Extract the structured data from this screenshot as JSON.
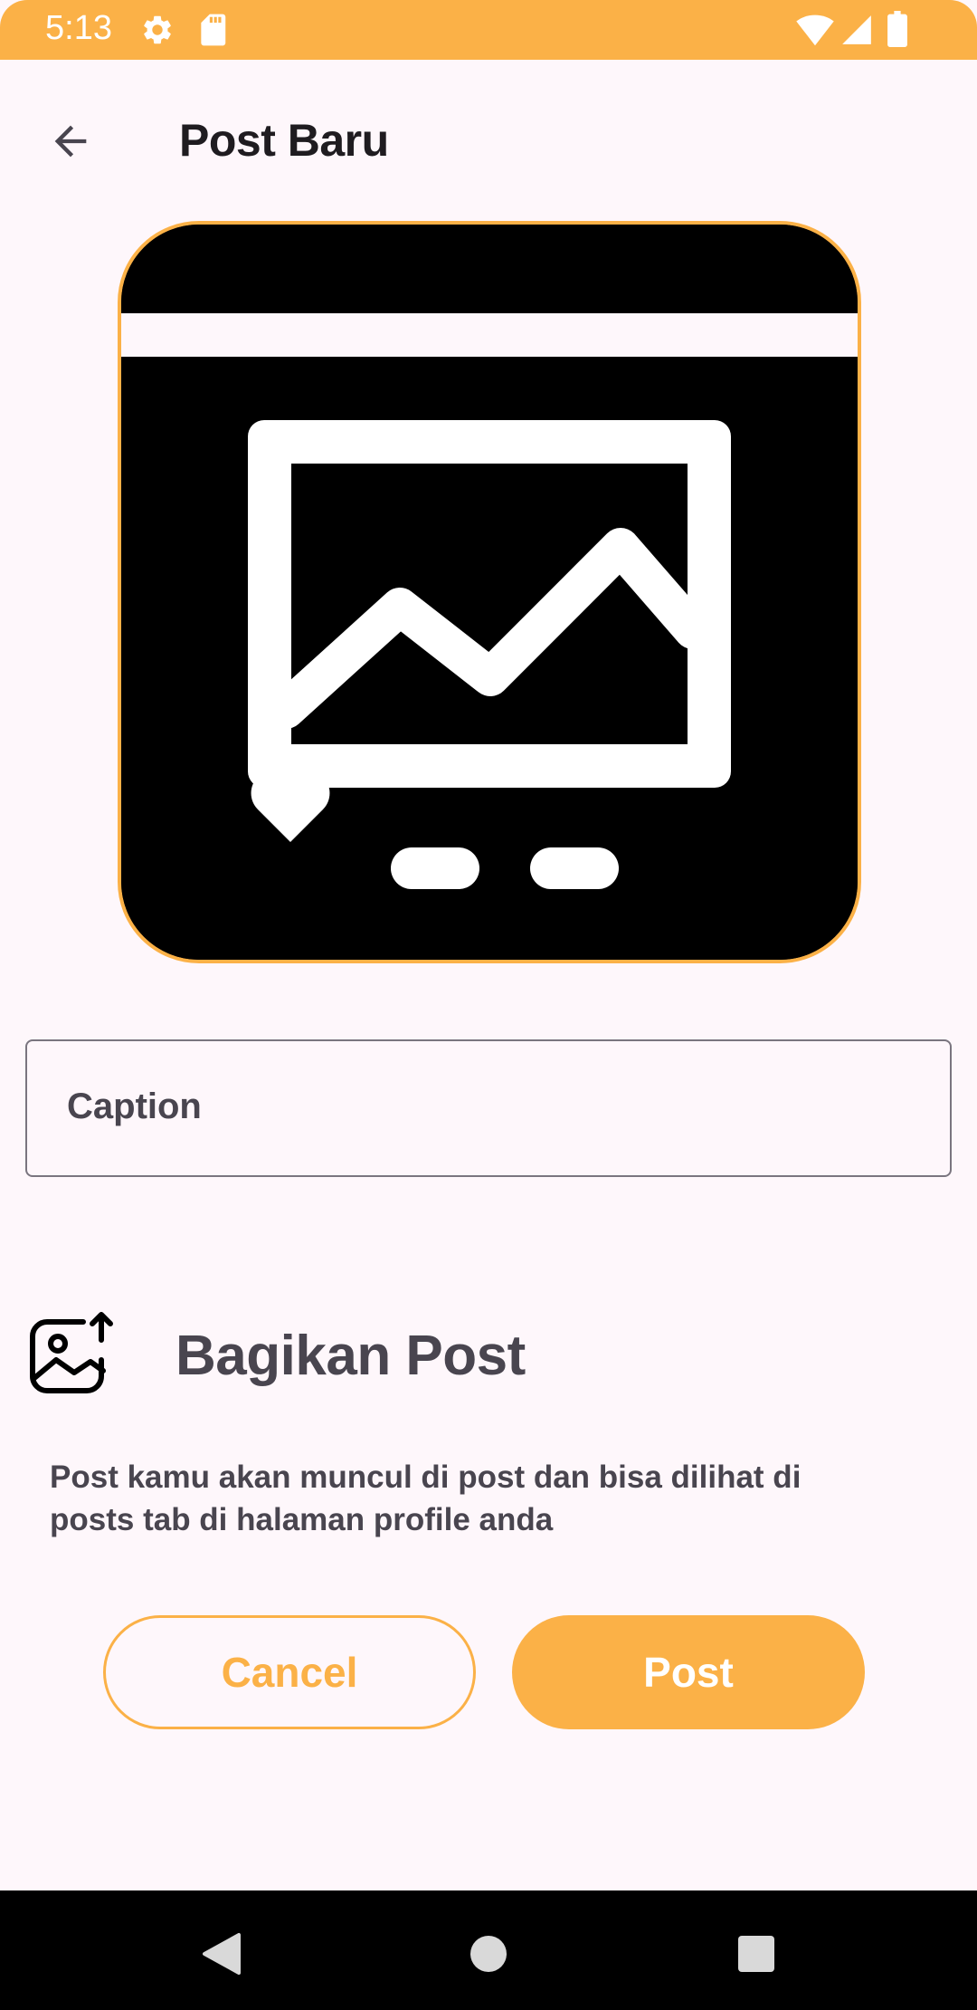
{
  "status_bar": {
    "time": "5:13",
    "icons": [
      "gear-icon",
      "sd-card-icon",
      "wifi-icon",
      "signal-icon",
      "battery-icon"
    ],
    "background": "#FBB147"
  },
  "app_bar": {
    "back_icon": "arrow-left-icon",
    "title": "Post Baru"
  },
  "image_preview": {
    "icon": "image-post-placeholder-icon",
    "border_color": "#FBB147"
  },
  "caption": {
    "label": "Caption",
    "value": ""
  },
  "share": {
    "icon": "image-upload-icon",
    "title": "Bagikan Post",
    "description": "Post kamu akan muncul di post dan bisa dilihat di posts tab di halaman profile anda"
  },
  "actions": {
    "cancel_label": "Cancel",
    "post_label": "Post"
  },
  "nav_bar": {
    "icons": [
      "back-triangle-icon",
      "home-circle-icon",
      "recents-square-icon"
    ]
  },
  "colors": {
    "accent": "#FBB147",
    "background": "#FEF7FB",
    "text_dark": "#1F1C20",
    "text_muted": "#49454F"
  }
}
